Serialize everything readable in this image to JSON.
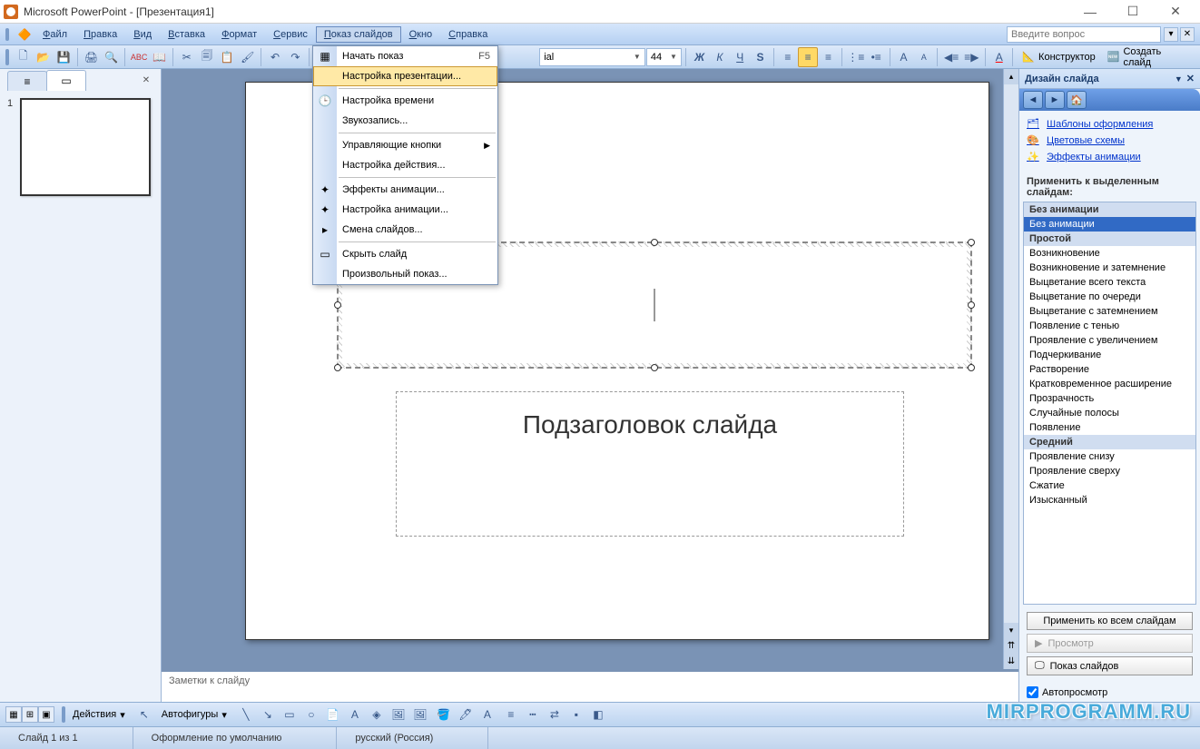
{
  "titlebar": {
    "title": "Microsoft PowerPoint - [Презентация1]"
  },
  "menubar": {
    "items": [
      "Файл",
      "Правка",
      "Вид",
      "Вставка",
      "Формат",
      "Сервис",
      "Показ слайдов",
      "Окно",
      "Справка"
    ],
    "active_index": 6,
    "search_placeholder": "Введите вопрос"
  },
  "dropdown": {
    "items": [
      {
        "label": "Начать показ",
        "shortcut": "F5",
        "icon": "▦"
      },
      {
        "label": "Настройка презентации...",
        "hover": true
      },
      {
        "sep": true
      },
      {
        "label": "Настройка времени",
        "icon": "🕒"
      },
      {
        "label": "Звукозапись..."
      },
      {
        "sep": true
      },
      {
        "label": "Управляющие кнопки",
        "submenu": true
      },
      {
        "label": "Настройка действия..."
      },
      {
        "sep": true
      },
      {
        "label": "Эффекты анимации...",
        "icon": "✦"
      },
      {
        "label": "Настройка анимации...",
        "icon": "✦"
      },
      {
        "label": "Смена слайдов...",
        "icon": "▸"
      },
      {
        "sep": true
      },
      {
        "label": "Скрыть слайд",
        "icon": "▭"
      },
      {
        "label": "Произвольный показ..."
      }
    ]
  },
  "toolbar": {
    "font": "ial",
    "size": "44",
    "designer": "Конструктор",
    "new_slide": "Создать слайд"
  },
  "slide_panel": {
    "thumb_number": "1"
  },
  "canvas": {
    "subtitle": "Подзаголовок слайда"
  },
  "notes": {
    "placeholder": "Заметки к слайду"
  },
  "task_pane": {
    "title": "Дизайн слайда",
    "links": [
      {
        "label": "Шаблоны оформления"
      },
      {
        "label": "Цветовые схемы"
      },
      {
        "label": "Эффекты анимации"
      }
    ],
    "section": "Применить к выделенным слайдам:",
    "groups": [
      {
        "header": "Без анимации",
        "items": [
          "Без анимации"
        ]
      },
      {
        "header": "Простой",
        "items": [
          "Возникновение",
          "Возникновение и затемнение",
          "Выцветание всего текста",
          "Выцветание по очереди",
          "Выцветание с затемнением",
          "Появление с тенью",
          "Проявление с увеличением",
          "Подчеркивание",
          "Растворение",
          "Кратковременное расширение",
          "Прозрачность",
          "Случайные полосы",
          "Появление"
        ]
      },
      {
        "header": "Средний",
        "items": [
          "Проявление снизу",
          "Проявление сверху",
          "Сжатие",
          "Изысканный"
        ]
      }
    ],
    "selected": "Без анимации",
    "apply_all": "Применить ко всем слайдам",
    "preview": "Просмотр",
    "slideshow": "Показ слайдов",
    "autopreview": "Автопросмотр"
  },
  "drawing": {
    "actions": "Действия",
    "autoshapes": "Автофигуры"
  },
  "status": {
    "slide": "Слайд 1 из 1",
    "template": "Оформление по умолчанию",
    "lang": "русский (Россия)"
  },
  "watermark": "MIRPROGRAMM.RU"
}
